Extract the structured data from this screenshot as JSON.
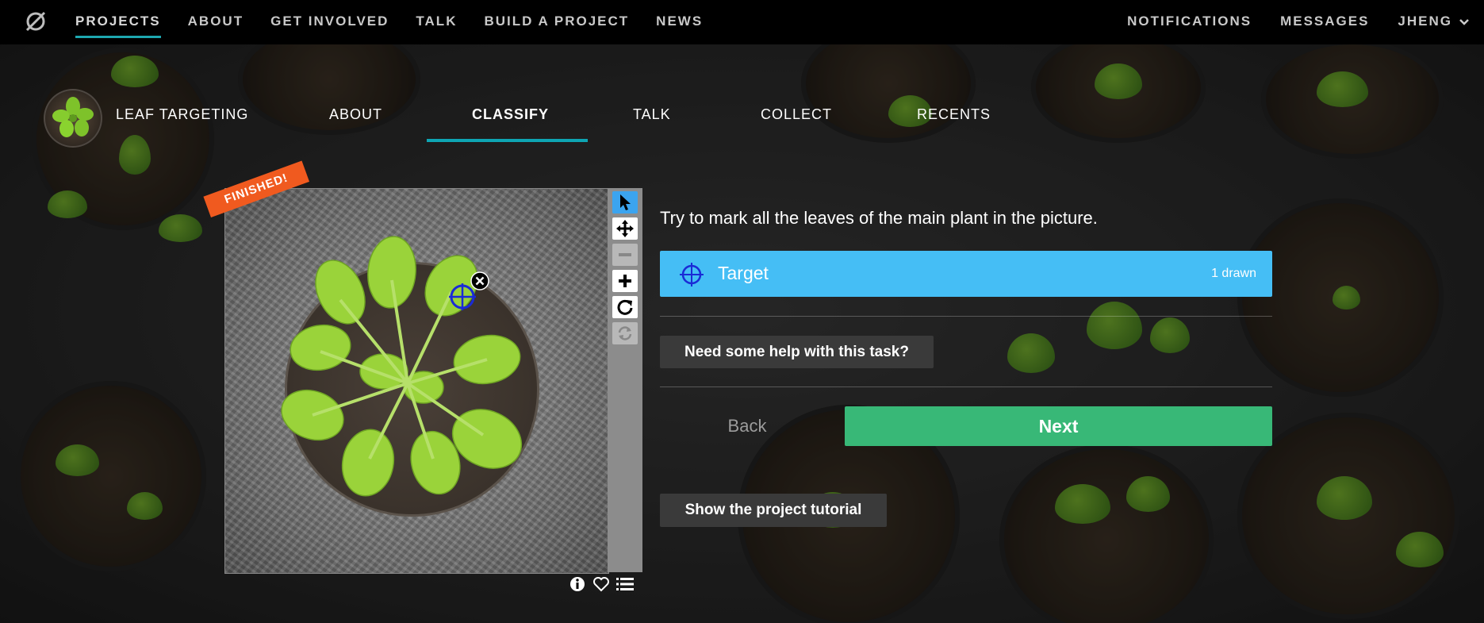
{
  "topnav": {
    "items": [
      {
        "label": "PROJECTS",
        "active": true
      },
      {
        "label": "ABOUT"
      },
      {
        "label": "GET INVOLVED"
      },
      {
        "label": "TALK"
      },
      {
        "label": "BUILD A PROJECT"
      },
      {
        "label": "NEWS"
      }
    ],
    "right": {
      "notifications": "NOTIFICATIONS",
      "messages": "MESSAGES",
      "user": "JHENG"
    }
  },
  "project": {
    "name": "LEAF TARGETING",
    "tabs": [
      {
        "label": "ABOUT"
      },
      {
        "label": "CLASSIFY",
        "active": true
      },
      {
        "label": "TALK"
      },
      {
        "label": "COLLECT"
      },
      {
        "label": "RECENTS"
      }
    ]
  },
  "viewer": {
    "badge": "FINISHED!",
    "tools": [
      "pointer-icon",
      "pan-icon",
      "zoom-out-icon",
      "zoom-in-icon",
      "rotate-icon",
      "reset-icon"
    ],
    "footer_icons": [
      "info-icon",
      "heart-icon",
      "collection-icon"
    ]
  },
  "task": {
    "instruction": "Try to mark all the leaves of the main plant in the picture.",
    "tool_label": "Target",
    "tool_count": "1 drawn",
    "help_label": "Need some help with this task?",
    "back_label": "Back",
    "next_label": "Next",
    "tutorial_label": "Show the project tutorial"
  },
  "colors": {
    "accent_teal": "#0ea5b3",
    "target_blue": "#45bef5",
    "next_green": "#38b877",
    "finished_orange": "#f05a1f",
    "marker_blue": "#1a2bd6"
  }
}
